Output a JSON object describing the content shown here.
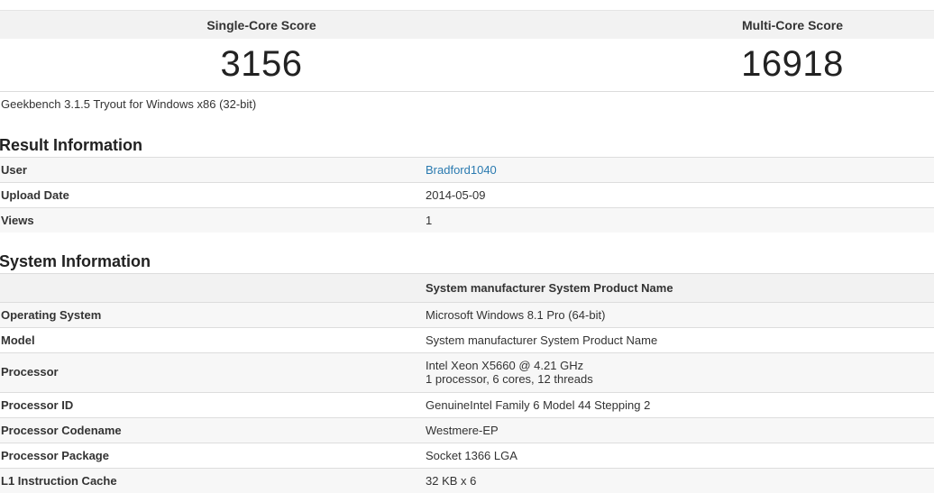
{
  "scores": {
    "single_label": "Single-Core Score",
    "multi_label": "Multi-Core Score",
    "single_value": "3156",
    "multi_value": "16918"
  },
  "version": "Geekbench 3.1.5 Tryout for Windows x86 (32-bit)",
  "result_info": {
    "title": "Result Information",
    "rows": [
      {
        "key": "User",
        "value": "Bradford1040"
      },
      {
        "key": "Upload Date",
        "value": "2014-05-09"
      },
      {
        "key": "Views",
        "value": "1"
      }
    ]
  },
  "system_info": {
    "title": "System Information",
    "header": "System manufacturer System Product Name",
    "rows": [
      {
        "key": "Operating System",
        "value": "Microsoft Windows 8.1 Pro (64-bit)"
      },
      {
        "key": "Model",
        "value": "System manufacturer System Product Name"
      },
      {
        "key": "Processor",
        "value": "Intel Xeon X5660 @ 4.21 GHz",
        "value2": "1 processor, 6 cores, 12 threads"
      },
      {
        "key": "Processor ID",
        "value": "GenuineIntel Family 6 Model 44 Stepping 2"
      },
      {
        "key": "Processor Codename",
        "value": "Westmere-EP"
      },
      {
        "key": "Processor Package",
        "value": "Socket 1366 LGA"
      },
      {
        "key": "L1 Instruction Cache",
        "value": "32 KB x 6"
      }
    ]
  },
  "colors": {
    "link": "#2a7ab0",
    "header_bg": "#f2f2f2",
    "alt_row_bg": "#f7f7f7"
  }
}
